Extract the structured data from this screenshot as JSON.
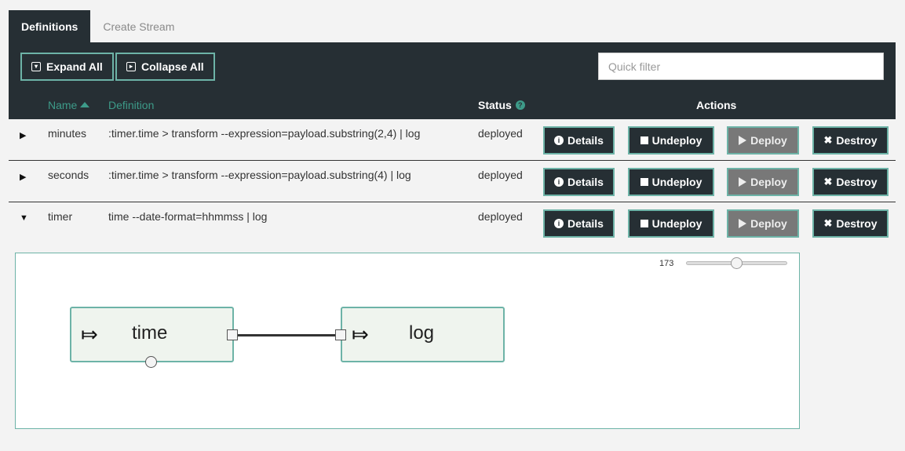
{
  "tabs": [
    {
      "label": "Definitions",
      "active": true
    },
    {
      "label": "Create Stream",
      "active": false
    }
  ],
  "toolbar": {
    "expand_all": "Expand All",
    "collapse_all": "Collapse All",
    "quick_filter_placeholder": "Quick filter",
    "quick_filter_value": ""
  },
  "table": {
    "columns": {
      "name": "Name",
      "definition": "Definition",
      "status": "Status",
      "actions": "Actions"
    },
    "sort": {
      "column": "Name",
      "direction": "ascending"
    },
    "rows": [
      {
        "name": "minutes",
        "definition": ":timer.time > transform --expression=payload.substring(2,4) | log",
        "status": "deployed",
        "expanded": false
      },
      {
        "name": "seconds",
        "definition": ":timer.time > transform --expression=payload.substring(4) | log",
        "status": "deployed",
        "expanded": false
      },
      {
        "name": "timer",
        "definition": "time --date-format=hhmmss | log",
        "status": "deployed",
        "expanded": true
      }
    ],
    "actions": {
      "details": "Details",
      "undeploy": "Undeploy",
      "deploy": "Deploy",
      "destroy": "Destroy"
    }
  },
  "graph": {
    "zoom_value": "173",
    "zoom_level": 0.5,
    "nodes": [
      {
        "label": "time",
        "icon": "source-arrow-icon"
      },
      {
        "label": "log",
        "icon": "sink-arrow-icon"
      }
    ]
  },
  "colors": {
    "dark": "#262f34",
    "accent": "#6db3a7",
    "header_text": "#3d9b89",
    "deploy_disabled": "#787878"
  }
}
